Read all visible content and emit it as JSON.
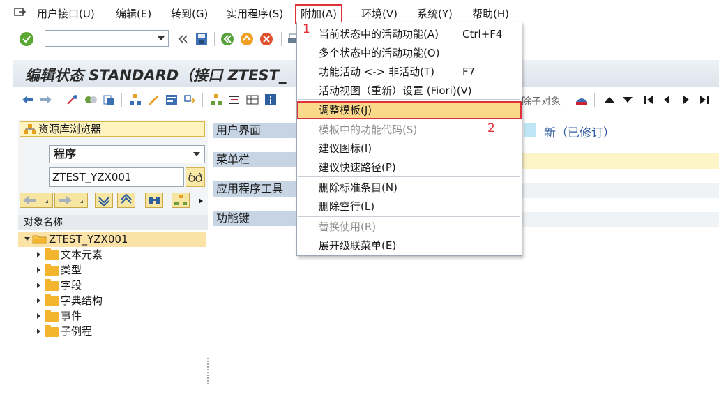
{
  "menubar": {
    "items": [
      "用户接口(U)",
      "编辑(E)",
      "转到(G)",
      "实用程序(S)",
      "附加(A)",
      "环境(V)",
      "系统(Y)",
      "帮助(H)"
    ]
  },
  "title": "编辑状态 STANDARD（接口 ZTEST_",
  "apptool": {
    "partial_label": "除子对象"
  },
  "left": {
    "repo_browser": "资源库浏览器",
    "type_select": "程序",
    "object_name": "ZTEST_YZX001",
    "tree_header": "对象名称",
    "tree_root": "ZTEST_YZX001",
    "tree_items": [
      "文本元素",
      "类型",
      "字段",
      "字典结构",
      "事件",
      "子例程"
    ]
  },
  "content": {
    "sections": [
      "用户界面",
      "菜单栏",
      "应用程序工具",
      "功能键"
    ],
    "status": "新（已修订）"
  },
  "dropdown": {
    "items": [
      {
        "label": "当前状态中的活动功能(A)",
        "shortcut": "Ctrl+F4",
        "disabled": false
      },
      {
        "label": "多个状态中的活动功能(O)",
        "shortcut": "",
        "disabled": false
      },
      {
        "label": "功能活动 <-> 非活动(T)",
        "shortcut": "F7",
        "disabled": false
      },
      {
        "label": "活动视图（重新）设置 (Fiori)(V)",
        "shortcut": "",
        "disabled": false
      },
      {
        "label": "调整模板(J)",
        "shortcut": "",
        "disabled": false,
        "highlighted": true
      },
      {
        "label": "模板中的功能代码(S)",
        "shortcut": "",
        "disabled": true
      },
      {
        "label": "建议图标(I)",
        "shortcut": "",
        "disabled": false
      },
      {
        "label": "建议快速路径(P)",
        "shortcut": "",
        "disabled": false
      },
      {
        "label": "删除标准条目(N)",
        "shortcut": "",
        "disabled": false
      },
      {
        "label": "删除空行(L)",
        "shortcut": "",
        "disabled": false
      },
      {
        "label": "替换使用(R)",
        "shortcut": "",
        "disabled": true
      },
      {
        "label": "展开级联菜单(E)",
        "shortcut": "",
        "disabled": false
      }
    ]
  },
  "annotations": {
    "first": "1",
    "second": "2"
  },
  "colors": {
    "accent_red": "#e0303a",
    "highlight": "#fbd98a",
    "section_blue": "#c7d4e4"
  }
}
